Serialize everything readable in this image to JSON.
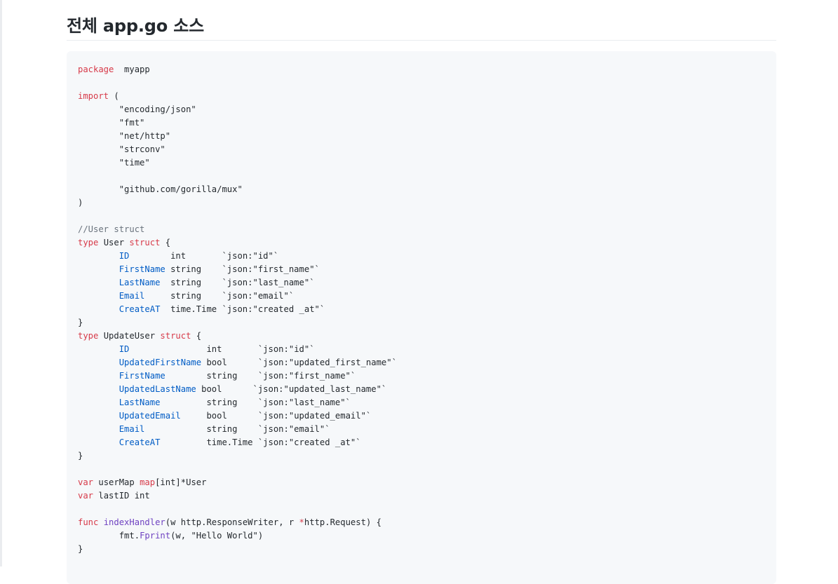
{
  "heading": "전체 app.go 소스",
  "code_language": "go",
  "syntax_colors": {
    "keyword": "#d73a49",
    "field": "#005cc5",
    "function": "#6f42c1",
    "comment": "#6a737d",
    "text": "#24292e",
    "code_background": "#f6f8fa"
  },
  "code_lines": [
    [
      [
        "k",
        "package"
      ],
      [
        "",
        "  myapp"
      ]
    ],
    [],
    [
      [
        "k",
        "import"
      ],
      [
        "",
        " ("
      ]
    ],
    [
      [
        "s",
        "\t\"encoding/json\""
      ]
    ],
    [
      [
        "s",
        "\t\"fmt\""
      ]
    ],
    [
      [
        "s",
        "\t\"net/http\""
      ]
    ],
    [
      [
        "s",
        "\t\"strconv\""
      ]
    ],
    [
      [
        "s",
        "\t\"time\""
      ]
    ],
    [],
    [
      [
        "s",
        "\t\"github.com/gorilla/mux\""
      ]
    ],
    [
      [
        "",
        ")"
      ]
    ],
    [],
    [
      [
        "c",
        "//User struct"
      ]
    ],
    [
      [
        "k",
        "type"
      ],
      [
        "",
        " User "
      ],
      [
        "k",
        "struct"
      ],
      [
        "",
        " {"
      ]
    ],
    [
      [
        "",
        "\t"
      ],
      [
        "f",
        "ID"
      ],
      [
        "",
        "        int       `json:\"id\"`"
      ]
    ],
    [
      [
        "",
        "\t"
      ],
      [
        "f",
        "FirstName"
      ],
      [
        "",
        " string    `json:\"first_name\"`"
      ]
    ],
    [
      [
        "",
        "\t"
      ],
      [
        "f",
        "LastName"
      ],
      [
        "",
        "  string    `json:\"last_name\"`"
      ]
    ],
    [
      [
        "",
        "\t"
      ],
      [
        "f",
        "Email"
      ],
      [
        "",
        "     string    `json:\"email\"`"
      ]
    ],
    [
      [
        "",
        "\t"
      ],
      [
        "f",
        "CreateAT"
      ],
      [
        "",
        "  time.Time `json:\"created _at\"`"
      ]
    ],
    [
      [
        "",
        "}"
      ]
    ],
    [
      [
        "k",
        "type"
      ],
      [
        "",
        " UpdateUser "
      ],
      [
        "k",
        "struct"
      ],
      [
        "",
        " {"
      ]
    ],
    [
      [
        "",
        "\t"
      ],
      [
        "f",
        "ID"
      ],
      [
        "",
        "               int       `json:\"id\"`"
      ]
    ],
    [
      [
        "",
        "\t"
      ],
      [
        "f",
        "UpdatedFirstName"
      ],
      [
        "",
        " bool      `json:\"updated_first_name\"`"
      ]
    ],
    [
      [
        "",
        "\t"
      ],
      [
        "f",
        "FirstName"
      ],
      [
        "",
        "        string    `json:\"first_name\"`"
      ]
    ],
    [
      [
        "",
        "\t"
      ],
      [
        "f",
        "UpdatedLastName"
      ],
      [
        "",
        " bool      `json:\"updated_last_name\"`"
      ]
    ],
    [
      [
        "",
        "\t"
      ],
      [
        "f",
        "LastName"
      ],
      [
        "",
        "         string    `json:\"last_name\"`"
      ]
    ],
    [
      [
        "",
        "\t"
      ],
      [
        "f",
        "UpdatedEmail"
      ],
      [
        "",
        "     bool      `json:\"updated_email\"`"
      ]
    ],
    [
      [
        "",
        "\t"
      ],
      [
        "f",
        "Email"
      ],
      [
        "",
        "            string    `json:\"email\"`"
      ]
    ],
    [
      [
        "",
        "\t"
      ],
      [
        "f",
        "CreateAT"
      ],
      [
        "",
        "         time.Time `json:\"created _at\"`"
      ]
    ],
    [
      [
        "",
        "}"
      ]
    ],
    [],
    [
      [
        "k",
        "var"
      ],
      [
        "",
        " userMap "
      ],
      [
        "k",
        "map"
      ],
      [
        "",
        "[int]*User"
      ]
    ],
    [
      [
        "k",
        "var"
      ],
      [
        "",
        " lastID int"
      ]
    ],
    [],
    [
      [
        "k",
        "func"
      ],
      [
        "",
        " "
      ],
      [
        "n",
        "indexHandler"
      ],
      [
        "",
        "(w http.ResponseWriter, r "
      ],
      [
        "k",
        "*"
      ],
      [
        "",
        "http.Request) {"
      ]
    ],
    [
      [
        "",
        "\tfmt."
      ],
      [
        "n",
        "Fprint"
      ],
      [
        "",
        "(w, \"Hello World\")"
      ]
    ],
    [
      [
        "",
        "}"
      ]
    ]
  ]
}
